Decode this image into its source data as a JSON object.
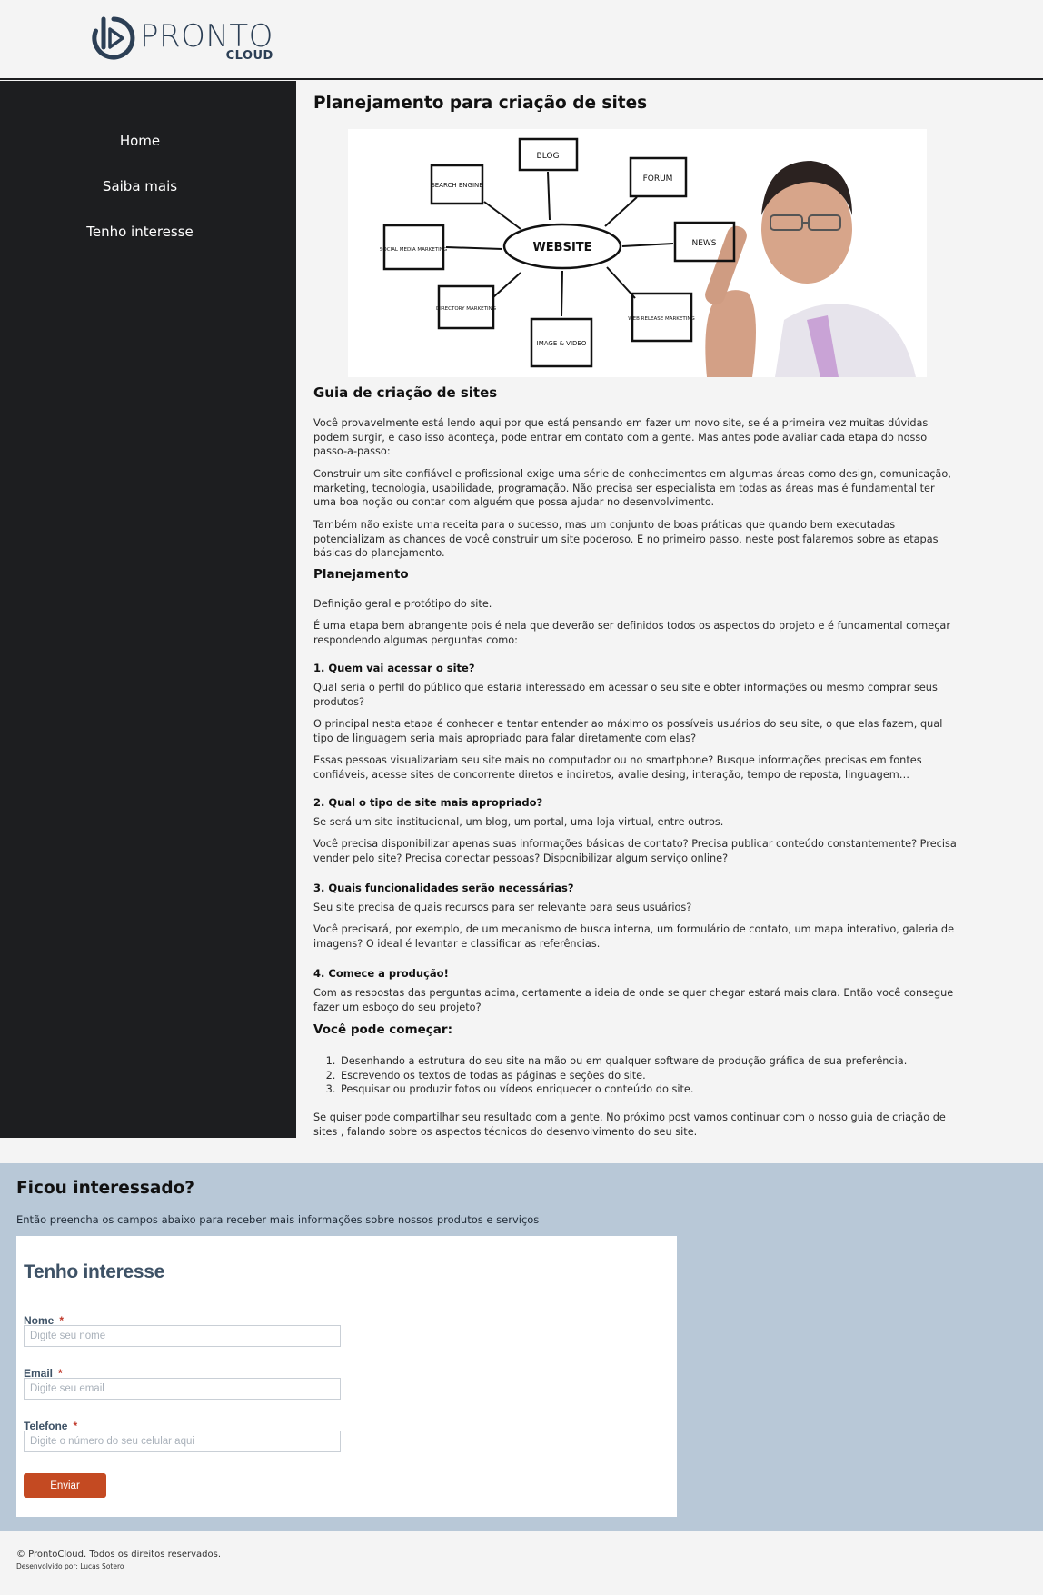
{
  "brand": {
    "name": "PRONTO",
    "sub": "CLOUD"
  },
  "nav": {
    "items": [
      {
        "label": "Home"
      },
      {
        "label": "Saiba mais"
      },
      {
        "label": "Tenho interesse"
      }
    ]
  },
  "article": {
    "title": "Planejamento para criação de sites",
    "hero": {
      "center": "WEBSITE",
      "nodes": [
        "BLOG",
        "SEARCH ENGINE",
        "FORUM",
        "SOCIAL MEDIA MARKETING",
        "NEWS",
        "DIRECTORY MARKETING",
        "IMAGE & VIDEO",
        "WEB RELEASE MARKETING"
      ]
    },
    "guide_heading": "Guia de criação de sites",
    "p1": "Você provavelmente está lendo aqui por que está pensando em fazer um novo site, se é a primeira vez muitas dúvidas podem surgir, e caso isso aconteça, pode entrar em contato com a gente. Mas antes pode avaliar cada etapa do nosso passo-a-passo:",
    "p2": "Construir um site confiável e profissional exige uma série de conhecimentos em algumas áreas como design, comunicação, marketing, tecnologia, usabilidade, programação. Não precisa ser especialista em todas as áreas mas é fundamental ter uma boa noção ou contar com alguém que possa ajudar no desenvolvimento.",
    "p3": "Também não existe uma receita para o sucesso, mas um conjunto de boas práticas que quando bem executadas potencializam as chances de você construir um site poderoso. E no primeiro passo, neste post falaremos sobre as etapas básicas do planejamento.",
    "planning_heading": "Planejamento",
    "p4": "Definição geral e protótipo do site.",
    "p5": "É uma etapa bem abrangente pois é nela que deverão ser definidos todos os aspectos do projeto e é fundamental começar respondendo algumas perguntas como:",
    "q1": "1. Quem vai acessar o site?",
    "q1_p1": "Qual seria o perfil do público que estaria interessado em acessar o seu site e obter informações ou mesmo comprar seus produtos?",
    "q1_p2": "O principal nesta etapa é conhecer e tentar entender ao máximo os possíveis usuários do seu site, o que elas fazem, qual tipo de linguagem seria mais apropriado para falar diretamente com elas?",
    "q1_p3": "Essas pessoas visualizariam seu site mais no computador ou no smartphone? Busque informações precisas em fontes confiáveis, acesse sites de concorrente diretos e indiretos, avalie desing, interação, tempo de reposta, linguagem…",
    "q2": "2. Qual o tipo de site mais apropriado?",
    "q2_p1": "Se será um site institucional, um blog, um portal, uma loja virtual, entre outros.",
    "q2_p2": "Você precisa disponibilizar apenas suas informações básicas de contato? Precisa publicar conteúdo constantemente? Precisa vender pelo site? Precisa conectar pessoas? Disponibilizar algum serviço online?",
    "q3": "3. Quais funcionalidades serão necessárias?",
    "q3_p1": "Seu site precisa de quais recursos para ser relevante para seus usuários?",
    "q3_p2": "Você precisará, por exemplo, de um mecanismo de busca interna, um formulário de contato, um mapa interativo, galeria de imagens? O ideal é levantar e classificar as referências.",
    "q4": "4. Comece a produção!",
    "q4_p1": "Com as respostas das perguntas acima, certamente a ideia de onde se quer chegar estará mais clara. Então você consegue fazer um esboço do seu projeto?",
    "start_heading": "Você pode começar:",
    "steps": [
      "Desenhando a estrutura do seu site na mão ou em qualquer software de produção gráfica de sua preferência.",
      "Escrevendo os textos de todas as páginas e seções do site.",
      "Pesquisar ou produzir fotos ou vídeos enriquecer o conteúdo do site."
    ],
    "closing": "Se quiser pode compartilhar seu resultado com a gente. No próximo post vamos continuar com o nosso guia de criação de sites , falando sobre os aspectos técnicos do desenvolvimento do seu site."
  },
  "interest": {
    "title": "Ficou interessado?",
    "subtitle": "Então preencha os campos abaixo para receber mais informações sobre nossos produtos e serviços",
    "form": {
      "title": "Tenho interesse",
      "name_label": "Nome",
      "name_placeholder": "Digite seu nome",
      "email_label": "Email",
      "email_placeholder": "Digite seu email",
      "phone_label": "Telefone",
      "phone_placeholder": "Digite o número do seu celular aqui",
      "required_mark": "*",
      "submit_label": "Enviar"
    }
  },
  "footer": {
    "copyright": "© ProntoCloud. Todos os direitos reservados.",
    "developer": "Desenvolvido por: Lucas Sotero"
  },
  "colors": {
    "sidebar": "#1d1e20",
    "interest_bg": "#b8c8d7",
    "brand": "#2c3f55",
    "button": "#c44a22"
  }
}
